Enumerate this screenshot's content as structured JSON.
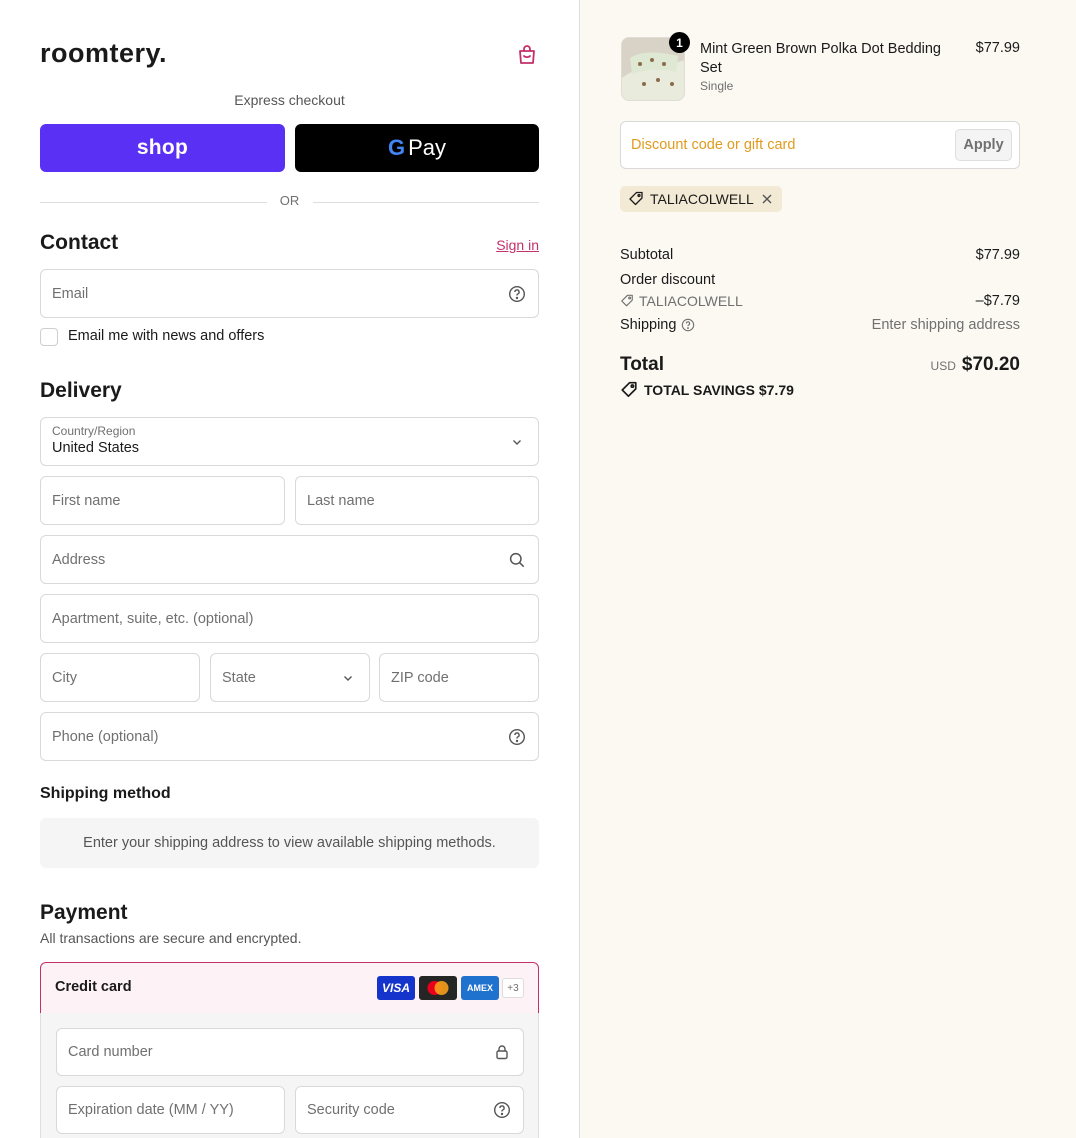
{
  "brand": {
    "logo": "roomtery."
  },
  "express": {
    "label": "Express checkout",
    "shop_label": "shop",
    "gpay_label": "Pay",
    "or": "OR"
  },
  "contact": {
    "title": "Contact",
    "signin": "Sign in",
    "email_placeholder": "Email",
    "newsletter_label": "Email me with news and offers"
  },
  "delivery": {
    "title": "Delivery",
    "country_label": "Country/Region",
    "country_value": "United States",
    "first_name": "First name",
    "last_name": "Last name",
    "address": "Address",
    "apartment": "Apartment, suite, etc. (optional)",
    "city": "City",
    "state": "State",
    "zip": "ZIP code",
    "phone": "Phone (optional)"
  },
  "shipping_method": {
    "title": "Shipping method",
    "message": "Enter your shipping address to view available shipping methods."
  },
  "payment": {
    "title": "Payment",
    "subtitle": "All transactions are secure and encrypted.",
    "credit_card_label": "Credit card",
    "card_brands": [
      "VISA",
      "MC",
      "AMEX"
    ],
    "more_brands": "+3",
    "card_number": "Card number",
    "expiration": "Expiration date (MM / YY)",
    "security_code": "Security code"
  },
  "summary": {
    "product": {
      "name": "Mint Green Brown Polka Dot Bedding Set",
      "variant": "Single",
      "price": "$77.99",
      "quantity": "1"
    },
    "discount_placeholder": "Discount code or gift card",
    "apply_label": "Apply",
    "applied_code": "TALIACOLWELL",
    "subtotal_label": "Subtotal",
    "subtotal_value": "$77.99",
    "order_discount_label": "Order discount",
    "discount_code": "TALIACOLWELL",
    "discount_value": "–$7.79",
    "shipping_label": "Shipping",
    "shipping_value": "Enter shipping address",
    "total_label": "Total",
    "currency": "USD",
    "total_value": "$70.20",
    "savings": "TOTAL SAVINGS $7.79"
  },
  "colors": {
    "shop_purple": "#5a31f4",
    "accent_pink": "#c4306b",
    "summary_bg": "#fcf9f3",
    "discount_placeholder": "#e09b1d"
  }
}
